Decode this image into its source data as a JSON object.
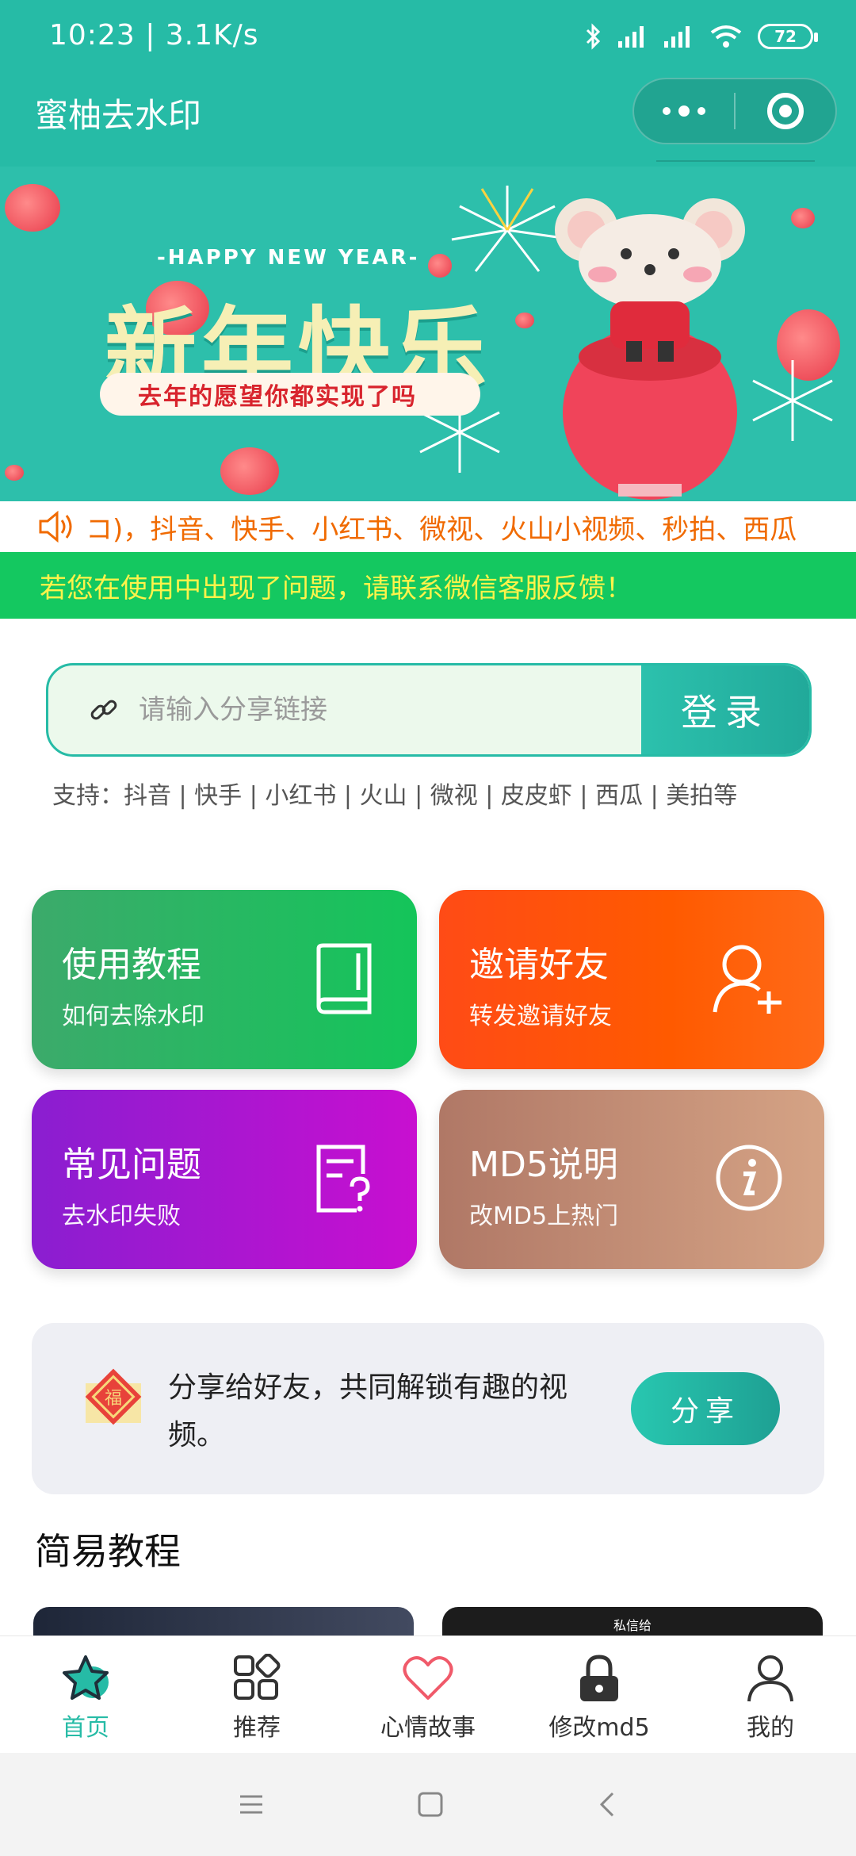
{
  "status_bar": {
    "time": "10:23",
    "speed": "3.1K/s",
    "battery": "72"
  },
  "nav": {
    "title": "蜜柚去水印"
  },
  "banner": {
    "subtitle": "-HAPPY NEW YEAR-",
    "headline": "新年快乐",
    "tagline": "去年的愿望你都实现了吗"
  },
  "marquee": {
    "text": "コ)，抖音、快手、小红书、微视、火山小视频、秒拍、西瓜"
  },
  "notice": {
    "text": "若您在使用中出现了问题，请联系微信客服反馈！"
  },
  "search": {
    "placeholder": "请输入分享链接",
    "button": "登录",
    "supports": "支持：抖音 | 快手 | 小红书 | 火山 | 微视 | 皮皮虾 | 西瓜 | 美拍等"
  },
  "cards": [
    {
      "title": "使用教程",
      "subtitle": "如何去除水印",
      "icon": "book-icon"
    },
    {
      "title": "邀请好友",
      "subtitle": "转发邀请好友",
      "icon": "add-user-icon"
    },
    {
      "title": "常见问题",
      "subtitle": "去水印失败",
      "icon": "question-doc-icon"
    },
    {
      "title": "MD5说明",
      "subtitle": "改MD5上热门",
      "icon": "info-icon"
    }
  ],
  "share": {
    "text": "分享给好友，共同解锁有趣的视频。",
    "button": "分享"
  },
  "section": {
    "title": "简易教程"
  },
  "thumbnails": [
    {
      "caption": ""
    },
    {
      "caption": "私信给"
    }
  ],
  "tabs": [
    {
      "label": "首页",
      "icon": "star-icon",
      "active": true
    },
    {
      "label": "推荐",
      "icon": "grid-icon",
      "active": false
    },
    {
      "label": "心情故事",
      "icon": "heart-icon",
      "active": false
    },
    {
      "label": "修改md5",
      "icon": "lock-icon",
      "active": false
    },
    {
      "label": "我的",
      "icon": "person-icon",
      "active": false
    }
  ],
  "colors": {
    "primary": "#26bba6",
    "notice_bg": "#14c860",
    "notice_text": "#fff34a",
    "marquee_text": "#f06a00"
  }
}
